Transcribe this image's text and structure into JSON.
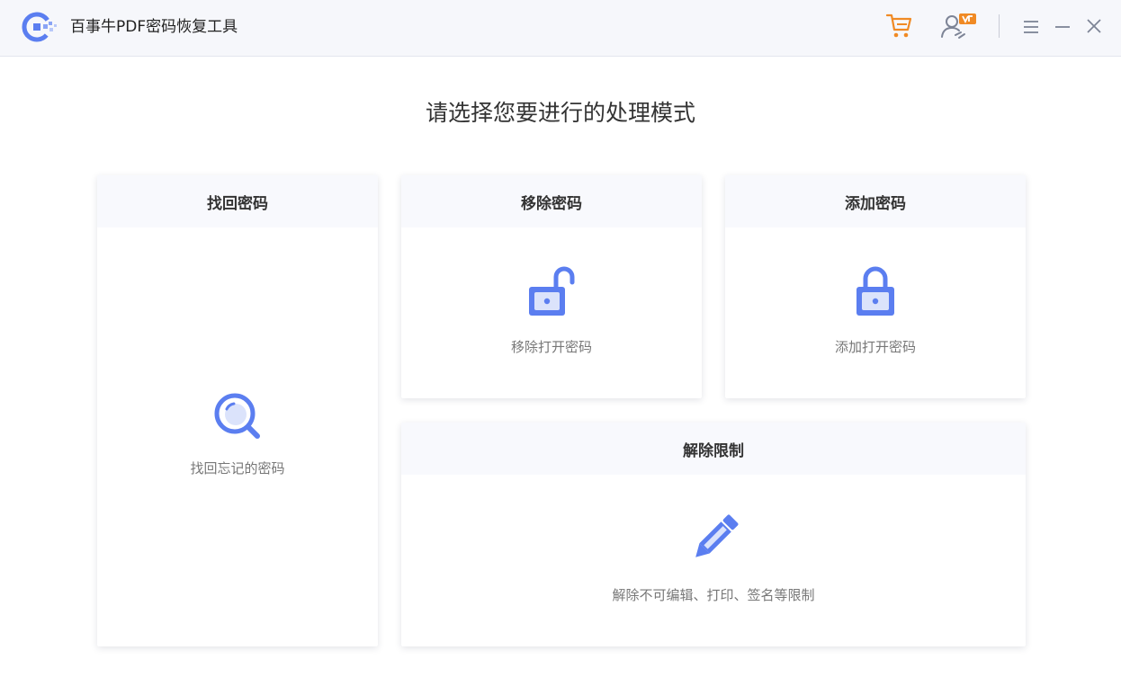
{
  "app": {
    "title": "百事牛PDF密码恢复工具",
    "accent_color": "#5b7ef0",
    "cart_color": "#f08a24",
    "badge_color": "#f08a24"
  },
  "titlebar": {
    "icons": [
      "app-logo-icon",
      "shopping-cart-icon",
      "user-vip-icon",
      "menu-icon",
      "minimize-icon",
      "close-icon"
    ]
  },
  "main": {
    "heading": "请选择您要进行的处理模式",
    "cards": {
      "recover": {
        "title": "找回密码",
        "description": "找回忘记的密码",
        "icon": "magnifier-icon"
      },
      "remove": {
        "title": "移除密码",
        "description": "移除打开密码",
        "icon": "unlocked-padlock-icon"
      },
      "add": {
        "title": "添加密码",
        "description": "添加打开密码",
        "icon": "locked-padlock-icon"
      },
      "unlock": {
        "title": "解除限制",
        "description": "解除不可编辑、打印、签名等限制",
        "icon": "pencil-icon"
      }
    }
  }
}
